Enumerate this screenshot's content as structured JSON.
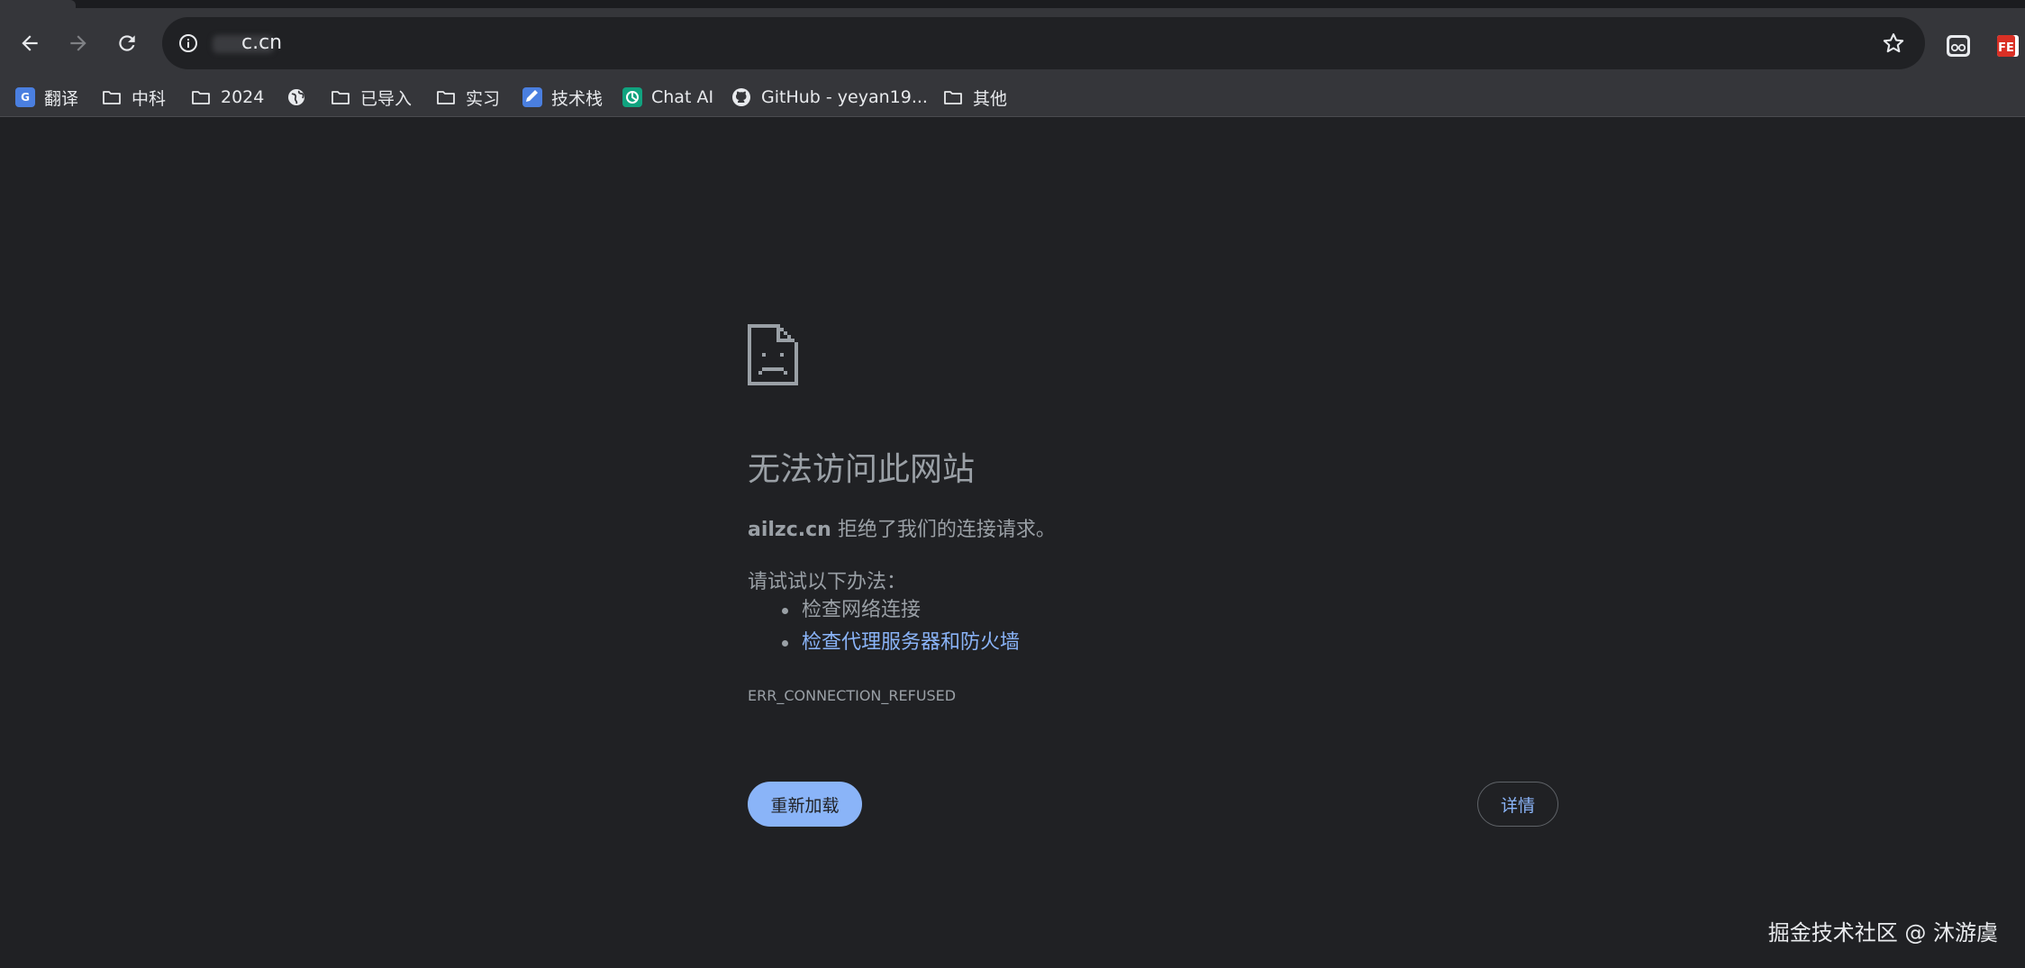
{
  "toolbar": {
    "url_host": "c.cn"
  },
  "bookmarks": [
    {
      "label": "翻译",
      "icon": "google-translate-icon"
    },
    {
      "label": "中科",
      "icon": "folder-icon"
    },
    {
      "label": "2024",
      "icon": "folder-icon"
    },
    {
      "label": "",
      "icon": "globe-icon"
    },
    {
      "label": "已导入",
      "icon": "folder-icon"
    },
    {
      "label": "实习",
      "icon": "folder-icon"
    },
    {
      "label": "技术栈",
      "icon": "pencil-icon"
    },
    {
      "label": "Chat AI",
      "icon": "chatgpt-icon"
    },
    {
      "label": "GitHub - yeyan19...",
      "icon": "github-icon"
    },
    {
      "label": "其他",
      "icon": "folder-icon"
    }
  ],
  "extensions": [
    {
      "icon": "glasses-icon"
    },
    {
      "icon": "fe-icon",
      "text": "FE"
    }
  ],
  "error": {
    "title": "无法访问此网站",
    "host": "ailzc.cn",
    "desc_suffix": " 拒绝了我们的连接请求。",
    "try_label": "请试试以下办法：",
    "suggestions": [
      "检查网络连接",
      "检查代理服务器和防火墙"
    ],
    "code": "ERR_CONNECTION_REFUSED",
    "reload_label": "重新加载",
    "details_label": "详情"
  },
  "watermark": "掘金技术社区 @ 沐游虞",
  "colors": {
    "page_bg": "#202124",
    "chrome_bg": "#35363a",
    "accent": "#8ab4f8",
    "muted_text": "#9aa0a6"
  }
}
